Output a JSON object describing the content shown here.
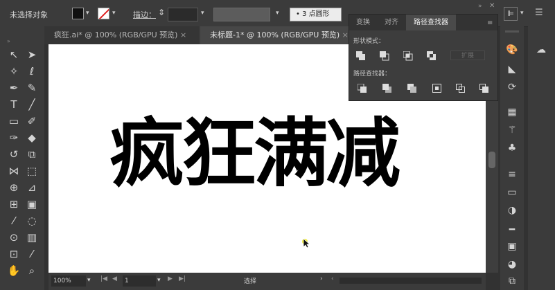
{
  "control_bar": {
    "selection_label": "未选择对象",
    "stroke_label": "描边：",
    "profile_value": "3 点圆形",
    "dropdown_icon": "chevron-down-icon"
  },
  "doc_tabs": [
    {
      "label": "疯狂.ai* @ 100% (RGB/GPU 预览)",
      "close": "×"
    },
    {
      "label": "未标题-1* @ 100% (RGB/GPU 预览)",
      "close": "×"
    }
  ],
  "canvas": {
    "headline": "疯狂满减"
  },
  "status_bar": {
    "zoom": "100%",
    "page": "1",
    "mode": "选择"
  },
  "pathfinder_panel": {
    "tabs": [
      "变换",
      "对齐",
      "路径查找器"
    ],
    "shape_modes_label": "形状模式：",
    "pathfinders_label": "路径查找器：",
    "expand_label": "扩展"
  },
  "colors": {
    "ui_bg": "#323232",
    "panel_bg": "#3b3b3b",
    "canvas_bg": "#ffffff",
    "text": "#000000",
    "cursor_highlight": "#f2ee3a"
  }
}
